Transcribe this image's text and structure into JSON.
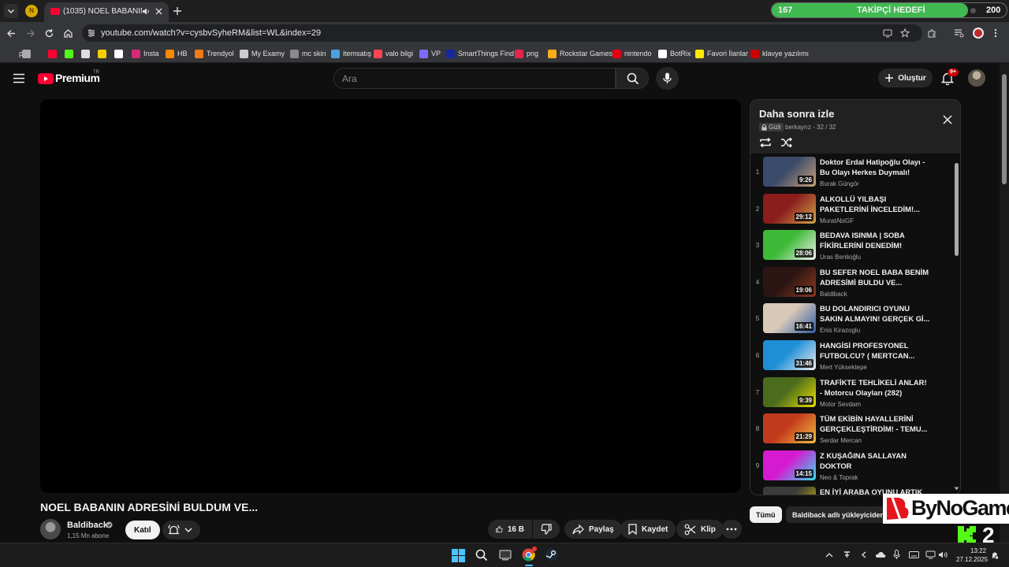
{
  "colors": {
    "yt_red": "#ff0033",
    "bg": "#0f0f0f",
    "follow_green": "#3fb950",
    "brand_red": "#e3161e",
    "kick_green": "#53fc18",
    "edge_blue": "#0078d4"
  },
  "browser": {
    "tab_title": "(1035) NOEL BABANIN ADR",
    "tab_badge": "N",
    "url": "youtube.com/watch?v=cysbvSyheRM&list=WL&index=29",
    "bookmarks": [
      {
        "label": "pc",
        "icon": "pc-icon",
        "color": "#555"
      },
      {
        "label": "",
        "icon": "apps-grid-icon",
        "color": "#aaa"
      },
      {
        "label": "",
        "icon": "youtube-icon",
        "color": "#ff0033"
      },
      {
        "label": "",
        "icon": "kick-icon",
        "color": "#53fc18"
      },
      {
        "label": "",
        "icon": "roblox-icon",
        "color": "#ddd"
      },
      {
        "label": "",
        "icon": "s-icon",
        "color": "#f5d000"
      },
      {
        "label": "",
        "icon": "x-icon",
        "color": "#fff"
      },
      {
        "label": "Insta",
        "icon": "instagram-icon",
        "color": "#d62976"
      },
      {
        "label": "HB",
        "icon": "hb-icon",
        "color": "#f28b00"
      },
      {
        "label": "Trendyol",
        "icon": "trendyol-icon",
        "color": "#f27a1a"
      },
      {
        "label": "My Examy",
        "icon": "examy-icon",
        "color": "#cccccc"
      },
      {
        "label": "mc skin",
        "icon": "mc-skin-icon",
        "color": "#8a8a8a"
      },
      {
        "label": "itemsatış",
        "icon": "itemsatis-icon",
        "color": "#4aa3df"
      },
      {
        "label": "valo bilgi",
        "icon": "valo-icon",
        "color": "#ff4655"
      },
      {
        "label": "VP",
        "icon": "vp-icon",
        "color": "#7f6cff"
      },
      {
        "label": "SmartThings Find",
        "icon": "smartthings-icon",
        "color": "#1428a0"
      },
      {
        "label": "png",
        "icon": "png-icon",
        "color": "#e2264d"
      },
      {
        "label": "Rockstar Games",
        "icon": "rockstar-icon",
        "color": "#fcaf17"
      },
      {
        "label": "nintendo",
        "icon": "nintendo-icon",
        "color": "#e60012"
      },
      {
        "label": "BotRix",
        "icon": "botrix-icon",
        "color": "#ffffff"
      },
      {
        "label": "Favori İlanlar",
        "icon": "sahibinden-icon",
        "color": "#ffe800"
      },
      {
        "label": "klavye yazılımı",
        "icon": "keyboard-sw-icon",
        "color": "#c00"
      }
    ]
  },
  "follow_goal": {
    "current": "167",
    "label": "TAKİPÇİ HEDEFİ",
    "target": "200",
    "progress": 0.835
  },
  "header": {
    "logo_text": "Premium",
    "region": "TR",
    "search_placeholder": "Ara",
    "create_label": "Oluştur",
    "notif_badge": "9+"
  },
  "playlist": {
    "title": "Daha sonra izle",
    "privacy": "Gizli",
    "owner_info": "berkayrız - 32 / 32",
    "items": [
      {
        "num": "1",
        "title": "Doktor Erdal Hatipoğlu Olayı - Bu Olayı Herkes Duymalı!",
        "channel": "Burak Güngör",
        "duration": "9:26",
        "thumb": [
          "#3a4a6a",
          "#c9a27a"
        ]
      },
      {
        "num": "2",
        "title": "ALKOLLÜ YILBAŞI PAKETLERİNİ İNCELEDİM!...",
        "channel": "MuratAbiGF",
        "duration": "29:12",
        "thumb": [
          "#8b1d1d",
          "#d4a64a"
        ]
      },
      {
        "num": "3",
        "title": "BEDAVA ISINMA | SOBA FİKİRLERİNİ DENEDİM!",
        "channel": "Uras Benlioğlu",
        "duration": "28:06",
        "thumb": [
          "#3fb938",
          "#f1f1f1"
        ]
      },
      {
        "num": "4",
        "title": "BU SEFER NOEL BABA BENİM ADRESİMİ BULDU VE...",
        "channel": "Baldiback",
        "duration": "19:06",
        "thumb": [
          "#2a1512",
          "#8c3a22"
        ]
      },
      {
        "num": "5",
        "title": "BU DOLANDIRICI OYUNU SAKIN ALMAYIN! GERÇEK Gİ...",
        "channel": "Enis Kirazoglu",
        "duration": "16:41",
        "thumb": [
          "#d9c9b8",
          "#2c5aa0"
        ]
      },
      {
        "num": "6",
        "title": "HANGİSİ PROFESYONEL FUTBOLCU? ( MERTCAN...",
        "channel": "Mert Yüksektepe",
        "duration": "31:46",
        "thumb": [
          "#1e8fd6",
          "#f0f0f0"
        ]
      },
      {
        "num": "7",
        "title": "TRAFİKTE TEHLİKELİ ANLAR! - Motorcu Olayları (282)",
        "channel": "Motor Sevdam",
        "duration": "9:39",
        "thumb": [
          "#4b6b1d",
          "#e8e000"
        ]
      },
      {
        "num": "8",
        "title": "TÜM EKİBİN HAYALLERİNİ GERÇEKLEŞTİRDİM! - TEMU...",
        "channel": "Serdar Mercan",
        "duration": "21:29",
        "thumb": [
          "#c23a1c",
          "#f0c040"
        ]
      },
      {
        "num": "9",
        "title": "Z KUŞAĞINA SALLAYAN DOKTOR",
        "channel": "Neo & Toprak",
        "duration": "14:15",
        "thumb": [
          "#d51bd2",
          "#31e0e8"
        ]
      },
      {
        "num": "",
        "title": "EN İYİ ARABA OYUNU ARTIK",
        "channel": "",
        "duration": "",
        "thumb": [
          "#3b3b3b",
          "#d9c700"
        ]
      }
    ]
  },
  "video": {
    "title": "NOEL BABANIN ADRESİNİ BULDUM VE...",
    "channel_name": "Baldiback",
    "subscribers": "1,15 Mn abone",
    "join_label": "Katıl",
    "likes": "16 B",
    "share_label": "Paylaş",
    "save_label": "Kaydet",
    "clip_label": "Klip"
  },
  "chips": {
    "all": "Tümü",
    "uploader": "Baldiback adlı yükleyiciden"
  },
  "overlay": {
    "brand": "ByNoGame",
    "kick_count": "2"
  },
  "taskbar": {
    "time": "13:22",
    "date": "27.12.2025"
  }
}
